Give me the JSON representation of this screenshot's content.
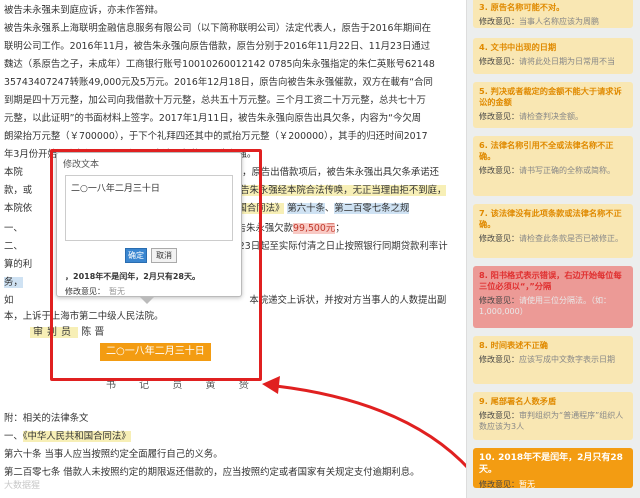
{
  "doc": {
    "lines": [
      "被告未永强未到庭应诉，亦未作答辩。",
      "被告朱永强系上海联明金融信息服务有限公司（以下简称联明公司）法定代表人，原告于2016年期间在",
      "联明公司工作。2016年11月，被告朱永强向原告借款，原告分别于2016年11月22日、11月23日通过",
      "魏达（系原告之子，未成年）工商银行账号10010260012142 0785向朱永强指定的朱仁英账号62148",
      "35743407247转账49,000元及5万元。2016年12月18日，原告向被告朱永强催款，双方在載有“合同",
      "到期是四十万元整，加公司向我借款十万元整，总共五十万元整。三个月工资二十万元整，总共七十万",
      "元整，以此证明”的书面材料上签字。2017年1月11日，被告朱永强向原告出具欠条，内容为“今欠周",
      "朗梁抬万元整（￥700000），于下个礼拜四还其中的贰抬万元整（￥200000），其手的归还时间2017",
      "年3月份开始逐步归还，最迟到10月查清，欠款人：朱永强。"
    ],
    "line10_a": "本院",
    "line10_b": "则，原告出借款项后，被告朱永强出具欠条承诺还",
    "line11_a": "款，或",
    "line11_b": "告朱永强经本院合法传唤，无正当理由拒不到庭，",
    "line12_a": "本院依",
    "line12_b": "和国合同法》",
    "line12_c": "第六十条",
    "line12_d": "第二百零七条",
    "line12_e": "之规",
    "line13_a": "一、",
    "line13_b": "告朱永强欠款",
    "line13_c": "99,500元",
    "line14_a": "二、",
    "line14_b": "23日起至实际付清之日止按照银行同期贷款利率计",
    "line15_a": "算的利",
    "line16_a": "务，",
    "line17_a": "如",
    "line17_b": "本院递交上诉状，并按对方当事人的人数提出副",
    "line18": "本，上诉于上海市第二中级人民法院。",
    "judge_label": "审判员",
    "judge_name": "陈 晋",
    "date_tag": "二○一八年二月三十日",
    "clerk_label": "书 记 员 黄 赟",
    "appendix_title": "附：相关的法律条文",
    "appendix_1a": "一、",
    "appendix_1b": "《中华人民共和国合同法》",
    "appendix_2": "第六十条    当事人应当按照约定全面履行自己的义务。",
    "appendix_3": "第二百零七条  借款人未按照约定的期限返还借款的，应当按照约定或者国家有关规定支付逾期利息。"
  },
  "popup": {
    "title": "修改文本",
    "text_value": "二○一八年二月三十日",
    "ok_label": "确定",
    "cancel_label": "取消",
    "desc": "，2018年不是闰年，2月只有28天。",
    "opinion_label": "修改意见：",
    "opinion_value": "暂无"
  },
  "panel": {
    "cards": [
      {
        "title": "3. 原告名称可能不对。",
        "label": "修改意见：",
        "value": "当事人名称应该为周鹏",
        "style": "yel"
      },
      {
        "title": "4. 文书中出现的日期",
        "label": "修改意见：",
        "value": "请将此处日期为日常用不当",
        "style": "yel"
      },
      {
        "title": "5. 判决或者裁定的金额不能大于请求诉讼的金额",
        "label": "修改意见：",
        "value": "请检查判决金额。",
        "style": "yel"
      },
      {
        "title": "6. 法律名称引用不全或法律名称不正确。",
        "label": "修改意见：",
        "value": "请书写正确的全称或简称。",
        "style": "yel"
      },
      {
        "title": "7. 该法律没有此项条款或法律名称不正确。",
        "label": "修改意见：",
        "value": "请检查此条款是否已被修正。",
        "style": "yel"
      },
      {
        "title": "8. 阳书格式表示错误，右边开始每位每三位必须以“，”分隔",
        "label": "修改意见：",
        "value": "请使用三位分隔法。（如：1,000,000）",
        "style": "pink"
      },
      {
        "title": "8. 时间表述不正确",
        "label": "修改意见：",
        "value": "应该写成中文数字表示日期",
        "style": "yel"
      },
      {
        "title": "9. 尾部署名人数矛盾",
        "label": "修改意见：",
        "value": "审判组织为“普通程序”组织人数应该为3人",
        "style": "yel"
      },
      {
        "title": "10. 2018年不是闰年，2月只有28天。",
        "label": "修改意见：",
        "value": "暂无",
        "style": "active"
      }
    ]
  },
  "watermark": "大数据猩",
  "colors": {
    "accent_orange": "#f39c12",
    "highlight_red": "#e02020",
    "panel_bg": "#eceeee"
  }
}
